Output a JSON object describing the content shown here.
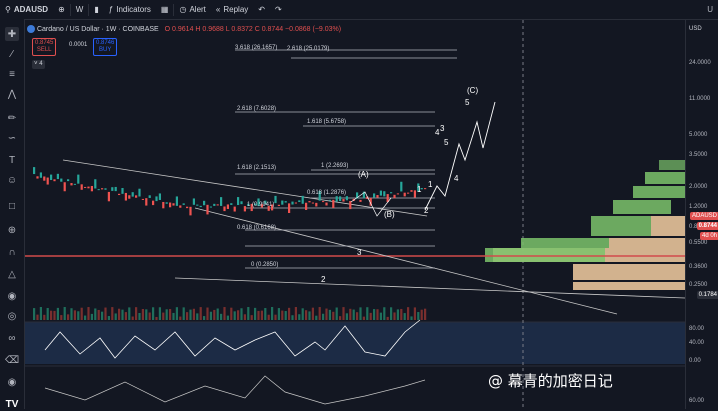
{
  "toolbar": {
    "symbol": "ADAUSD",
    "interval": "W",
    "indicators_label": "Indicators",
    "alert_label": "Alert",
    "replay_label": "Replay",
    "right_cut": "U"
  },
  "legend": {
    "title": "Cardano / US Dollar · 1W · COINBASE",
    "ohlc": "O 0.9614  H 0.9688  L 0.8372  C 0.8744  −0.0868 (−9.03%)",
    "sell_price": "0.8745",
    "sell_label": "SELL",
    "spread": "0.0001",
    "buy_price": "0.8746",
    "buy_label": "BUY",
    "collapse": "4"
  },
  "price_axis": {
    "currency": "USD",
    "labels": [
      "24.0000",
      "11.0000",
      "5.0000",
      "3.5000",
      "2.0000",
      "1.2000",
      "0.8000",
      "0.5500",
      "0.3600",
      "0.2500",
      "0.1784"
    ],
    "current_symbol": "ADAUSD",
    "current_price": "0.8744",
    "current_sub": "4d 0h",
    "indicator_labels": [
      "80.00",
      "40.00",
      "0.00",
      "60.00"
    ]
  },
  "fib_labels": [
    "3.618 (26.1657)",
    "2.618 (25.0179)",
    "2.618 (7.6028)",
    "1.618 (5.6758)",
    "1.618 (2.1513)",
    "1 (2.2693)",
    "0.618 (1.2876)",
    "1 (0.9941)",
    "0.618 (0.6168)",
    "0 (0.2850)"
  ],
  "wave_labels": [
    "(C)",
    "5",
    "3",
    "4",
    "1",
    "2",
    "(A)",
    "(B)",
    "3",
    "4",
    "5",
    "1",
    "2"
  ],
  "watermark": "@ 幕青的加密日记",
  "bottom_logo": "TV"
}
